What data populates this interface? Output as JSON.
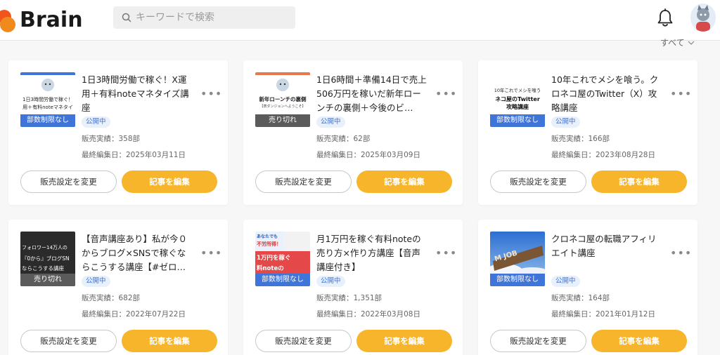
{
  "header": {
    "logo_text": "Brain",
    "search_placeholder": "キーワードで検索"
  },
  "filter": {
    "label": "すべて"
  },
  "colors": {
    "accent": "#f7b52b",
    "status_blue": "#3f75d8",
    "logo_red": "#f0551c",
    "logo_orange": "#f08a1c"
  },
  "icons": {
    "search": "search-icon",
    "bell": "bell-icon",
    "more": "more-icon",
    "chevron": "chevron-down-icon"
  },
  "cards": [
    {
      "title": "1日3時間労働で稼ぐ！X運用＋有料noteマネタイズ講座",
      "status": "公開中",
      "sales": "販売実績：358部",
      "edited": "最終編集日：2025年03月11日",
      "thumb_badge": "部数制限なし",
      "thumb_text_1": "1日3時間労働で稼ぐ！",
      "thumb_text_2": "用＋有料noteマネタイ",
      "btn_outline": "販売設定を変更",
      "btn_fill": "記事を編集"
    },
    {
      "title": "1日6時間＋準備14日で売上506万円を稼いだ新年ローンチの裏側＋今後のビ…",
      "status": "公開中",
      "sales": "販売実績：62部",
      "edited": "最終編集日：2025年03月09日",
      "thumb_badge": "売り切れ",
      "thumb_text_1": "新年ローンチの裏側",
      "thumb_text_2": "【表ダンジョンへようこそ】",
      "btn_outline": "販売設定を変更",
      "btn_fill": "記事を編集"
    },
    {
      "title": "10年これでメシを喰う。クロネコ屋のTwitter（X）攻略講座",
      "status": "公開中",
      "sales": "販売実績：166部",
      "edited": "最終編集日：2023年08月28日",
      "thumb_badge": "部数制限なし",
      "thumb_text_1": "10年これでメシを喰う",
      "thumb_text_2": "ネコ屋のTwitter",
      "thumb_text_3": "攻略講座",
      "btn_outline": "販売設定を変更",
      "btn_fill": "記事を編集"
    },
    {
      "title": "【音声講座あり】私が今０からブログ×SNSで稼ぐならこうする講座【#ゼロ…",
      "status": "公開中",
      "sales": "販売実績：682部",
      "edited": "最終編集日：2022年07月22日",
      "thumb_badge": "売り切れ",
      "thumb_text_1": "フォロワー14万人の",
      "thumb_text_2": "『0から』ブログSN",
      "thumb_text_3": "ならこうする講座",
      "btn_outline": "販売設定を変更",
      "btn_fill": "記事を編集"
    },
    {
      "title": "月1万円を稼ぐ有料noteの売り方×作り方講座【音声講座付き】",
      "status": "公開中",
      "sales": "販売実績：1,351部",
      "edited": "最終編集日：2022年03月08日",
      "thumb_badge": "部数制限なし",
      "thumb_text_1": "あなたでも",
      "thumb_text_2": "不労所得！",
      "thumb_text_3": "1万円を稼ぐ",
      "thumb_text_4": "料noteの",
      "btn_outline": "販売設定を変更",
      "btn_fill": "記事を編集"
    },
    {
      "title": "クロネコ屋の転職アフィリエイト講座",
      "status": "公開中",
      "sales": "販売実績：164部",
      "edited": "最終編集日：2021年01月12日",
      "thumb_badge": "部数制限なし",
      "thumb_text_1": "M JOB",
      "btn_outline": "販売設定を変更",
      "btn_fill": "記事を編集"
    }
  ]
}
